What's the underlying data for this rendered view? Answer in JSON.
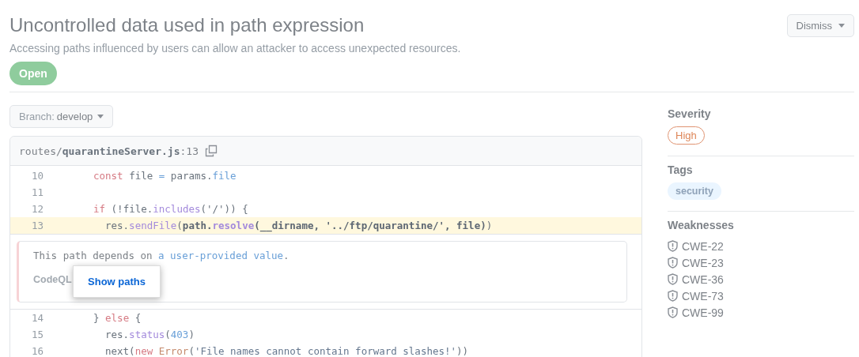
{
  "alert": {
    "title": "Uncontrolled data used in path expression",
    "description": "Accessing paths influenced by users can allow an attacker to access unexpected resources.",
    "state": "Open",
    "dismiss": "Dismiss"
  },
  "branch": {
    "label": "Branch:",
    "value": "develop"
  },
  "file": {
    "dir": "routes/",
    "name": "quarantineServer.js",
    "line": ":13"
  },
  "code_before": [
    {
      "number": "10",
      "highlighted": false,
      "tokens": [
        {
          "kind": "keyword",
          "text": "const"
        },
        {
          "kind": "plain",
          "text": " file "
        },
        {
          "kind": "prop",
          "text": "="
        },
        {
          "kind": "plain",
          "text": " params."
        },
        {
          "kind": "prop",
          "text": "file"
        }
      ]
    },
    {
      "number": "11",
      "highlighted": false
    },
    {
      "number": "12",
      "highlighted": false,
      "tokens": [
        {
          "kind": "keyword",
          "text": "if"
        },
        {
          "kind": "plain",
          "text": " (!file."
        },
        {
          "kind": "fn",
          "text": "includes"
        },
        {
          "kind": "plain",
          "text": "('/')) {"
        }
      ],
      "children": [
        {
          "number": "13",
          "highlighted": true,
          "tokens": [
            {
              "kind": "plain",
              "text": "res."
            },
            {
              "kind": "fn",
              "text": "sendFile"
            },
            {
              "kind": "plain",
              "text": "("
            },
            {
              "kind": "strong",
              "text": "path."
            },
            {
              "kind": "strong-fn",
              "text": "resolve"
            },
            {
              "kind": "strong",
              "text": "(__dirname, '../ftp/quarantine/', file)"
            },
            {
              "kind": "plain",
              "text": ")"
            }
          ]
        }
      ]
    }
  ],
  "message": {
    "parts": [
      {
        "kind": "text",
        "text": "This path depends on "
      },
      {
        "kind": "link",
        "text": "a user-provided value"
      },
      {
        "kind": "text",
        "text": "."
      }
    ],
    "tool": "CodeQL",
    "popup": "Show paths"
  },
  "code_after": [
    {
      "number": "14",
      "highlighted": false,
      "tokens": [
        {
          "kind": "plain",
          "text": "} "
        },
        {
          "kind": "keyword",
          "text": "else"
        },
        {
          "kind": "plain",
          "text": " {"
        }
      ],
      "children": [
        {
          "number": "15",
          "highlighted": false,
          "tokens": [
            {
              "kind": "plain",
              "text": "res."
            },
            {
              "kind": "fn",
              "text": "status"
            },
            {
              "kind": "plain",
              "text": "("
            },
            {
              "kind": "number",
              "text": "403"
            },
            {
              "kind": "plain",
              "text": ")"
            }
          ]
        },
        {
          "number": "16",
          "highlighted": false,
          "tokens": [
            {
              "kind": "plain",
              "text": "next("
            },
            {
              "kind": "keyword",
              "text": "new "
            },
            {
              "kind": "type",
              "text": "Error"
            },
            {
              "kind": "plain",
              "text": "("
            },
            {
              "kind": "string",
              "text": "'File names cannot contain forward slashes!'"
            },
            {
              "kind": "plain",
              "text": "))"
            }
          ]
        }
      ]
    }
  ],
  "sidebar": {
    "severity": {
      "heading": "Severity",
      "value": "High"
    },
    "tags": {
      "heading": "Tags",
      "items": [
        "security"
      ]
    },
    "weaknesses": {
      "heading": "Weaknesses",
      "items": [
        "CWE-22",
        "CWE-23",
        "CWE-36",
        "CWE-73",
        "CWE-99"
      ]
    }
  }
}
